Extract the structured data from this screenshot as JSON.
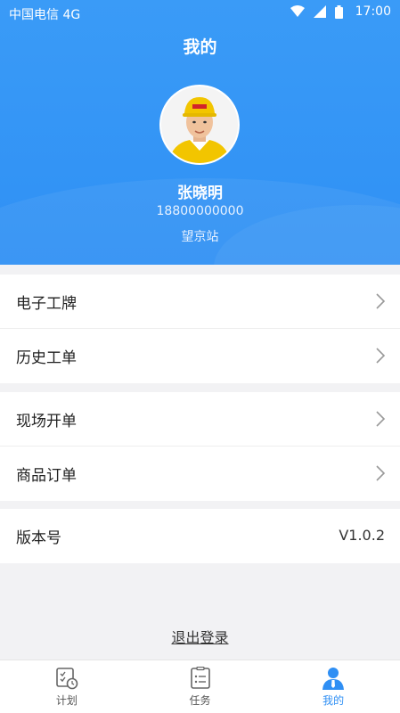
{
  "status_bar": {
    "carrier": "中国电信 4G",
    "time": "17:00"
  },
  "header": {
    "title": "我的"
  },
  "profile": {
    "name": "张晓明",
    "phone": "18800000000",
    "station": "望京站"
  },
  "menu_groups": [
    [
      {
        "label": "电子工牌"
      },
      {
        "label": "历史工单"
      }
    ],
    [
      {
        "label": "现场开单"
      },
      {
        "label": "商品订单"
      }
    ]
  ],
  "version": {
    "label": "版本号",
    "value": "V1.0.2"
  },
  "logout_label": "退出登录",
  "tabs": [
    {
      "label": "计划",
      "icon": "plan-icon"
    },
    {
      "label": "任务",
      "icon": "task-icon"
    },
    {
      "label": "我的",
      "icon": "profile-icon",
      "active": true
    }
  ],
  "colors": {
    "primary": "#2f8ff4",
    "background": "#f2f2f4"
  }
}
